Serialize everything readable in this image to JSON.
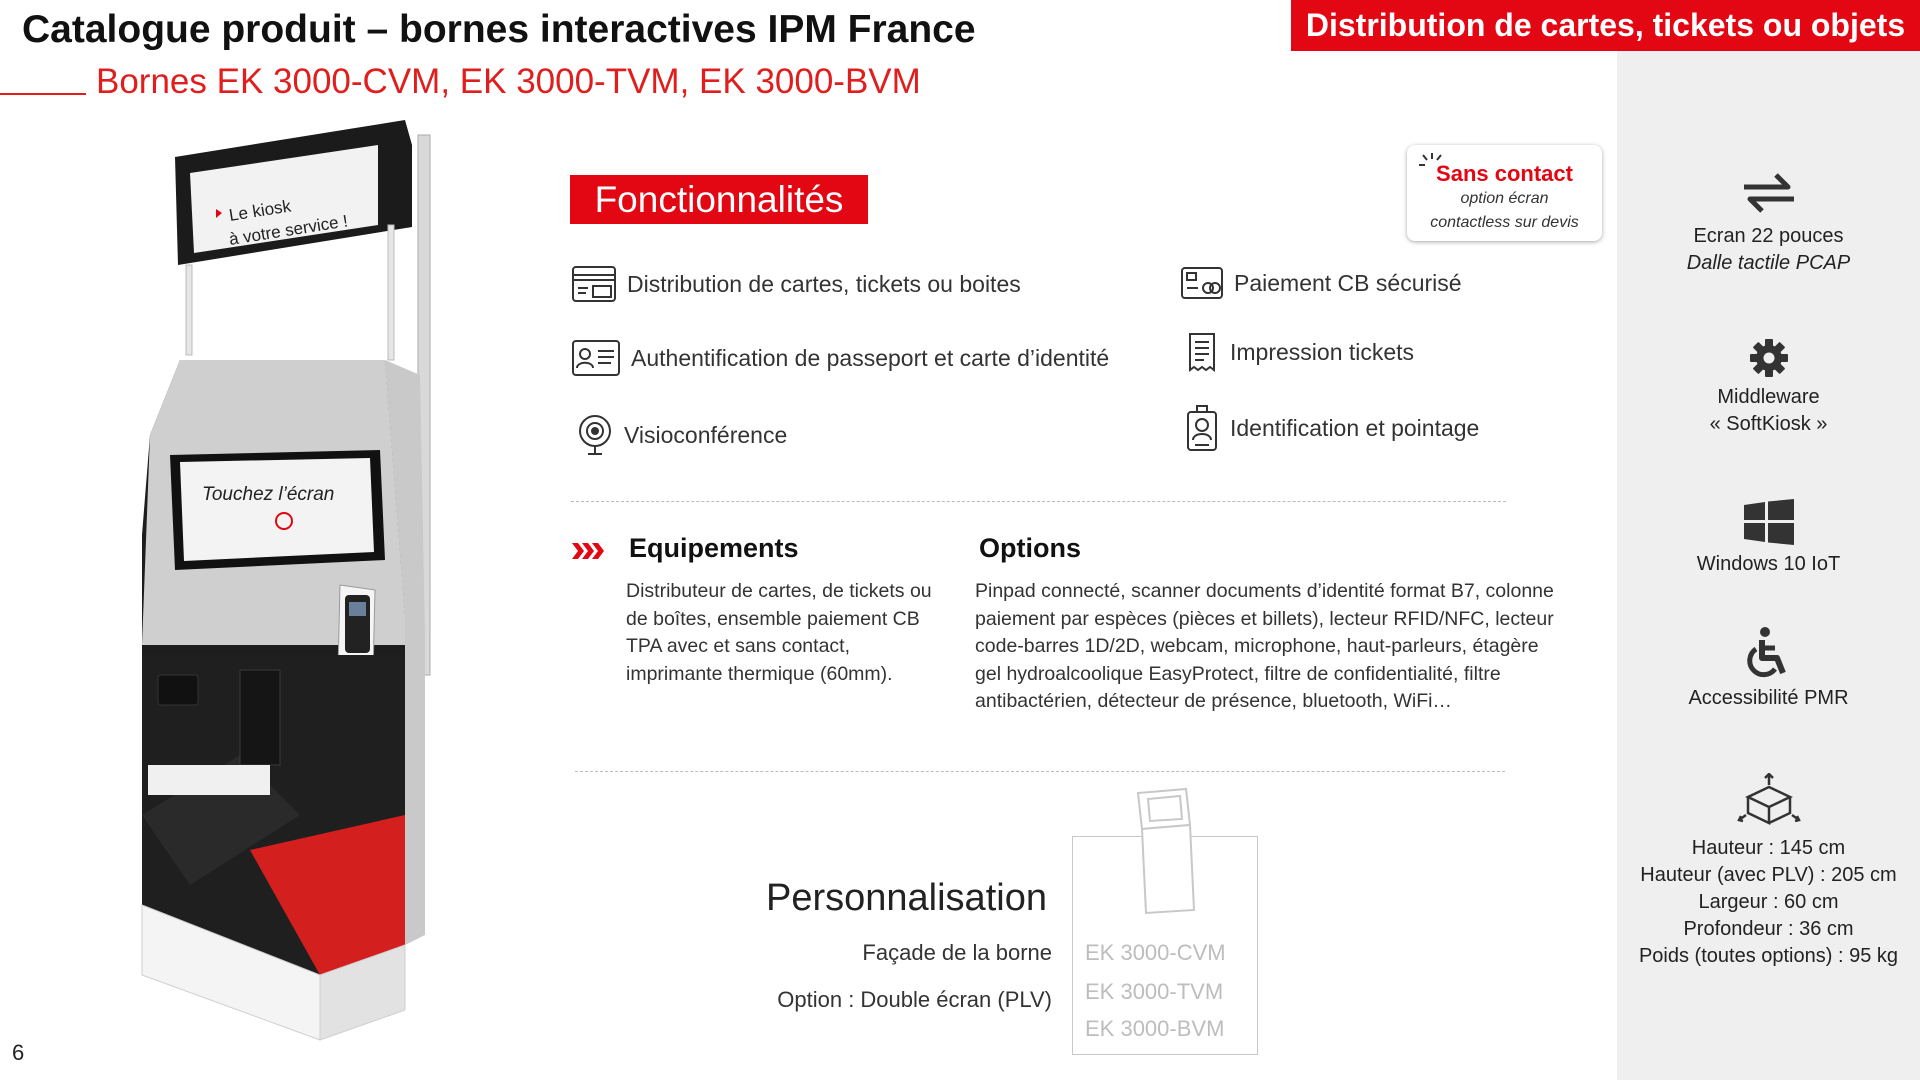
{
  "header": {
    "title": "Catalogue produit – bornes interactives IPM France",
    "subtitle": "Bornes EK 3000-CVM, EK 3000-TVM, EK 3000-BVM",
    "banner": "Distribution de cartes, tickets ou objets"
  },
  "kiosk": {
    "top_screen_line1": "Le kiosk",
    "top_screen_line2": "à votre service !",
    "main_screen": "Touchez l’écran"
  },
  "features": {
    "heading": "Fonctionnalités",
    "contactless_title": "Sans contact",
    "contactless_line1": "option écran",
    "contactless_line2": "contactless sur devis",
    "items": [
      {
        "label": "Distribution de cartes, tickets ou boites",
        "icon": "card-dispenser-icon"
      },
      {
        "label": "Authentification de passeport et carte d’identité",
        "icon": "id-card-icon"
      },
      {
        "label": "Visioconférence",
        "icon": "webcam-icon"
      },
      {
        "label": "Paiement CB sécurisé",
        "icon": "credit-card-icon"
      },
      {
        "label": "Impression tickets",
        "icon": "receipt-icon"
      },
      {
        "label": "Identification et pointage",
        "icon": "badge-icon"
      }
    ]
  },
  "equipements": {
    "heading": "Equipements",
    "text": "Distributeur de cartes, de tickets ou de boîtes, ensemble paiement CB TPA avec et sans contact, imprimante thermique (60mm)."
  },
  "options": {
    "heading": "Options",
    "text": "Pinpad connecté, scanner documents d’identité format B7, colonne paiement par espèces (pièces et billets), lecteur RFID/NFC, lecteur code-barres 1D/2D, webcam, microphone, haut-parleurs, étagère gel hydroalcoolique EasyProtect, filtre de confidentialité, filtre antibactérien, détecteur de présence, bluetooth, WiFi…"
  },
  "personnalisation": {
    "heading": "Personnalisation",
    "line1": "Façade de la borne",
    "line2": "Option : Double écran (PLV)",
    "models": [
      "EK 3000-CVM",
      "EK 3000-TVM",
      "EK 3000-BVM"
    ]
  },
  "specs": {
    "screen_line1": "Ecran 22 pouces",
    "screen_line2": "Dalle tactile PCAP",
    "middleware_line1": "Middleware",
    "middleware_line2": "« SoftKiosk »",
    "os": "Windows 10 IoT",
    "access": "Accessibilité PMR",
    "dims": [
      "Hauteur : 145 cm",
      "Hauteur (avec PLV) : 205 cm",
      "Largeur : 60 cm",
      "Profondeur : 36 cm",
      "Poids (toutes options) : 95 kg"
    ]
  },
  "page_number": "6",
  "colors": {
    "accent": "#e30613",
    "sidebar": "#efefef"
  }
}
